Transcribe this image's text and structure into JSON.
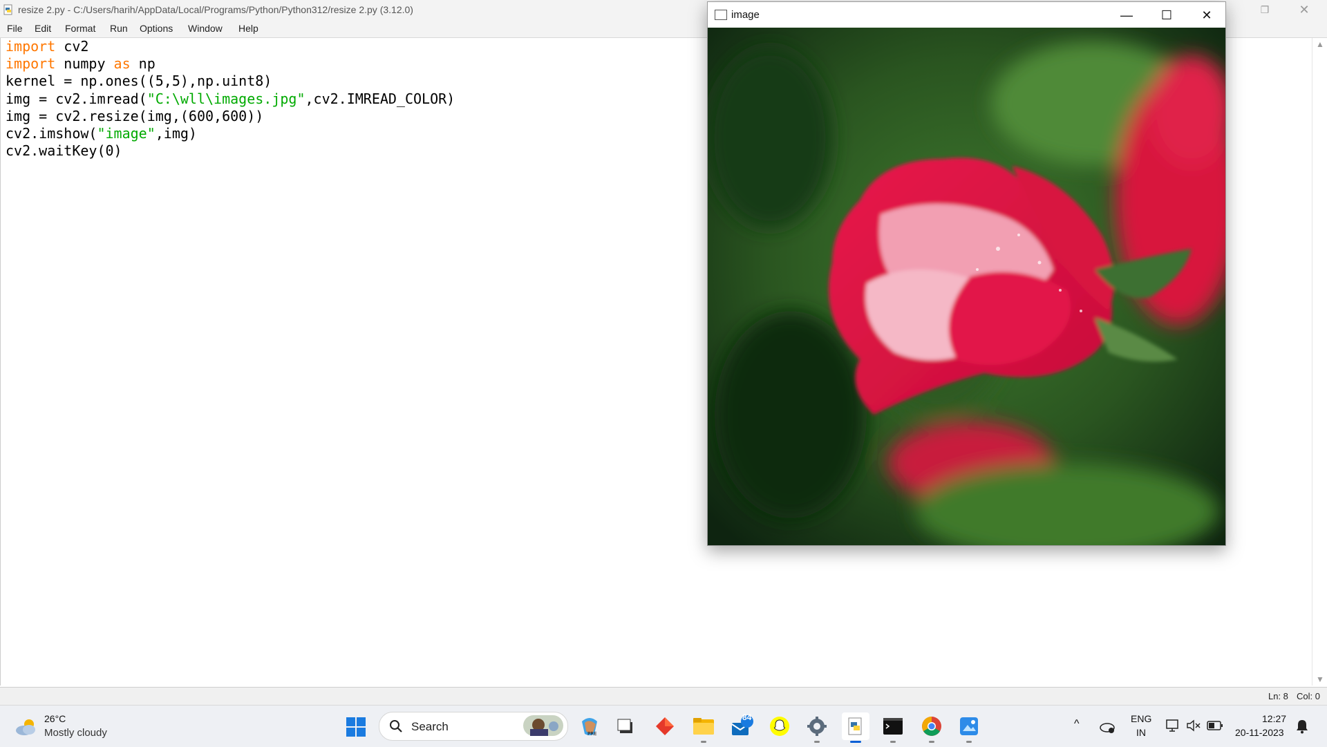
{
  "idle_window": {
    "title": "resize 2.py - C:/Users/harih/AppData/Local/Programs/Python/Python312/resize 2.py (3.12.0)",
    "menu": [
      "File",
      "Edit",
      "Format",
      "Run",
      "Options",
      "Window",
      "Help"
    ],
    "code_lines": [
      [
        {
          "t": "import",
          "k": "kw"
        },
        {
          "t": " cv2",
          "k": ""
        }
      ],
      [
        {
          "t": "import",
          "k": "kw"
        },
        {
          "t": " numpy ",
          "k": ""
        },
        {
          "t": "as",
          "k": "kw"
        },
        {
          "t": " np",
          "k": ""
        }
      ],
      [
        {
          "t": "kernel = np.ones((5,5),np.uint8)",
          "k": ""
        }
      ],
      [
        {
          "t": "img = cv2.imread(",
          "k": ""
        },
        {
          "t": "\"C:\\wll\\images.jpg\"",
          "k": "str"
        },
        {
          "t": ",cv2.IMREAD_COLOR)",
          "k": ""
        }
      ],
      [
        {
          "t": "img = cv2.resize(img,(600,600))",
          "k": ""
        }
      ],
      [
        {
          "t": "cv2.imshow(",
          "k": ""
        },
        {
          "t": "\"image\"",
          "k": "str"
        },
        {
          "t": ",img)",
          "k": ""
        }
      ],
      [
        {
          "t": "cv2.waitKey(0)",
          "k": ""
        }
      ]
    ],
    "status": {
      "ln": "Ln: 8",
      "col": "Col: 0"
    }
  },
  "image_window": {
    "title": "image",
    "minimize_icon": "minimize-icon",
    "maximize_icon": "maximize-icon",
    "close_icon": "close-icon",
    "content": "red-rose-photo"
  },
  "taskbar": {
    "weather": {
      "temp": "26°C",
      "condition": "Mostly cloudy"
    },
    "search_label": "Search",
    "mail_badge": "84",
    "language": {
      "line1": "ENG",
      "line2": "IN"
    },
    "time": "12:27",
    "date": "20-11-2023"
  }
}
